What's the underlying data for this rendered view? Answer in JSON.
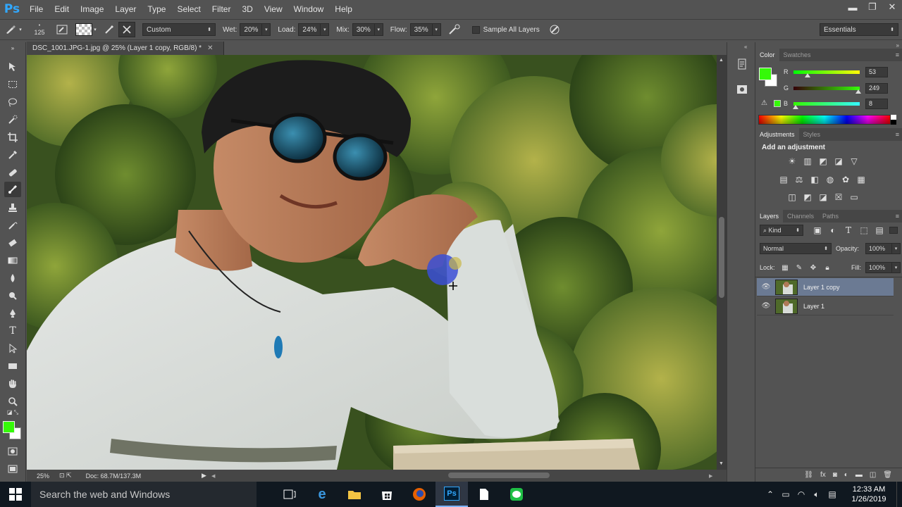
{
  "app": {
    "logo": "Ps"
  },
  "menu": [
    "File",
    "Edit",
    "Image",
    "Layer",
    "Type",
    "Select",
    "Filter",
    "3D",
    "View",
    "Window",
    "Help"
  ],
  "window_controls": {
    "minimize": "▬",
    "restore": "❐",
    "close": "✕"
  },
  "options": {
    "brush_size": "125",
    "preset": "Custom",
    "wet_label": "Wet:",
    "wet_value": "20%",
    "load_label": "Load:",
    "load_value": "24%",
    "mix_label": "Mix:",
    "mix_value": "30%",
    "flow_label": "Flow:",
    "flow_value": "35%",
    "sample_all_layers": "Sample All Layers",
    "workspace": "Essentials"
  },
  "document": {
    "tab_title": "DSC_1001.JPG-1.jpg @ 25% (Layer 1 copy, RGB/8) *",
    "zoom": "25%",
    "doc_size": "Doc: 68.7M/137.3M"
  },
  "color_panel": {
    "tabs": [
      "Color",
      "Swatches"
    ],
    "foreground": "#35f908",
    "channels": [
      {
        "letter": "R",
        "value": "53",
        "level": 0.21
      },
      {
        "letter": "G",
        "value": "249",
        "level": 0.98
      },
      {
        "letter": "B",
        "value": "8",
        "level": 0.03
      }
    ]
  },
  "adjustments_panel": {
    "tabs": [
      "Adjustments",
      "Styles"
    ],
    "heading": "Add an adjustment"
  },
  "layers_panel": {
    "tabs": [
      "Layers",
      "Channels",
      "Paths"
    ],
    "filter": "Kind",
    "blend_mode": "Normal",
    "opacity_label": "Opacity:",
    "opacity_value": "100%",
    "lock_label": "Lock:",
    "fill_label": "Fill:",
    "fill_value": "100%",
    "layers": [
      {
        "name": "Layer 1 copy",
        "selected": true
      },
      {
        "name": "Layer 1",
        "selected": false
      }
    ]
  },
  "taskbar": {
    "search_placeholder": "Search the web and Windows",
    "time": "12:33 AM",
    "date": "1/26/2019"
  },
  "colors": {
    "accent_blue": "#31a8ff",
    "panel_bg": "#535353",
    "selected_layer": "#6b7a93"
  }
}
